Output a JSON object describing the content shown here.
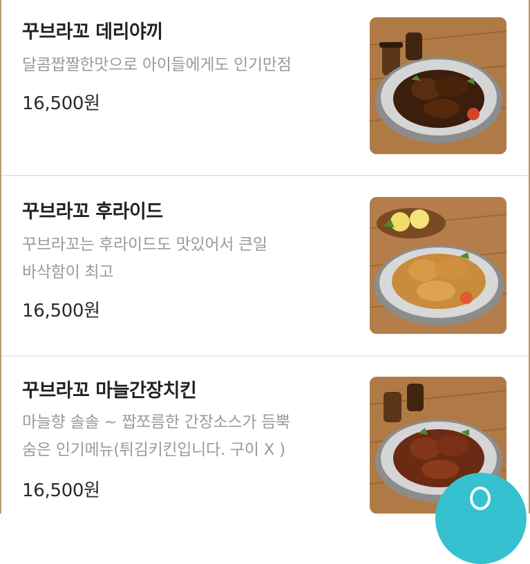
{
  "menu": {
    "items": [
      {
        "title": "꾸브라꼬 데리야끼",
        "desc_lines": [
          "달콤짭짤한맛으로 아이들에게도 인기만점"
        ],
        "price": "16,500원",
        "image_icon": "teriyaki-chicken-photo"
      },
      {
        "title": "꾸브라꼬 후라이드",
        "desc_lines": [
          "꾸브라꼬는 후라이드도 맛있어서 큰일",
          "바삭함이 최고"
        ],
        "price": "16,500원",
        "image_icon": "fried-chicken-photo"
      },
      {
        "title": "꾸브라꼬 마늘간장치킨",
        "desc_lines": [
          "마늘향 솔솔 ~ 짭쪼름한 간장소스가 듬뿍",
          "숨은 인기메뉴(튀김키킨입니다. 구이 X )"
        ],
        "price": "16,500원",
        "image_icon": "garlic-soy-chicken-photo"
      }
    ]
  },
  "colors": {
    "frame": "#b59a72",
    "title": "#222222",
    "desc": "#9a9a9a",
    "fab": "#35c1cf"
  },
  "fab_icon": "chat-icon"
}
